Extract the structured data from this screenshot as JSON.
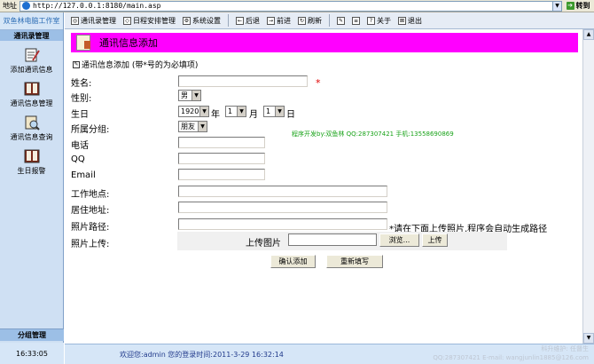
{
  "browser": {
    "address_label": "地址",
    "url": "http://127.0.0.1:8180/main.asp",
    "go_label": "转到"
  },
  "sidebar": {
    "app_title": "双鱼林电脑工作室",
    "section_title": "通讯录管理",
    "items": [
      {
        "label": "添加通讯信息",
        "icon": "notepad-icon"
      },
      {
        "label": "通讯信息管理",
        "icon": "book-icon"
      },
      {
        "label": "通讯信息查询",
        "icon": "search-book-icon"
      },
      {
        "label": "生日报警",
        "icon": "alarm-book-icon"
      }
    ],
    "footer": "分组管理",
    "time": "16:33:05"
  },
  "toolbar": {
    "items": [
      {
        "label": "通讯录管理",
        "icon": "contacts-icon"
      },
      {
        "label": "日程安排管理",
        "icon": "schedule-icon"
      },
      {
        "label": "系统设置",
        "icon": "settings-icon"
      },
      {
        "label": "后退",
        "icon": "back-icon"
      },
      {
        "label": "前进",
        "icon": "forward-icon"
      },
      {
        "label": "刷新",
        "icon": "refresh-icon"
      },
      {
        "label": "",
        "icon": "edit-icon"
      },
      {
        "label": "",
        "icon": "list-icon"
      },
      {
        "label": "关于",
        "icon": "about-icon"
      },
      {
        "label": "退出",
        "icon": "exit-icon"
      }
    ]
  },
  "page": {
    "banner_title": "通讯信息添加",
    "subtitle": "通讯信息添加 (带*号的为必填项)",
    "required_mark": "*",
    "developer_note": "程序开发by:双鱼林 QQ:287307421 手机:13558690869",
    "photo_hint": "*请在下面上传照片,程序会自动生成路径"
  },
  "form": {
    "name_label": "姓名:",
    "gender_label": "性别:",
    "gender_value": "男",
    "birthday_label": "生日",
    "birth_year": "1920",
    "year_unit": "年",
    "birth_month": "1",
    "month_unit": "月",
    "birth_day": "1",
    "day_unit": "日",
    "group_label": "所属分组:",
    "group_value": "朋友",
    "phone_label": "电话",
    "qq_label": "QQ",
    "email_label": "Email",
    "work_label": "工作地点:",
    "home_label": "居住地址:",
    "photo_path_label": "照片路径:",
    "photo_upload_label": "照片上传:",
    "upload_image_label": "上传图片",
    "browse_button": "浏览...",
    "upload_button": "上传",
    "submit_button": "确认添加",
    "reset_button": "重新填写"
  },
  "status": {
    "welcome": "欢迎您:admin 您的登录时间:2011-3-29 16:32:14",
    "watermark_line1": "科升维护: 任督生",
    "watermark_line2": "QQ:287307421 E-mail: wangjunlin1885@126.com"
  }
}
